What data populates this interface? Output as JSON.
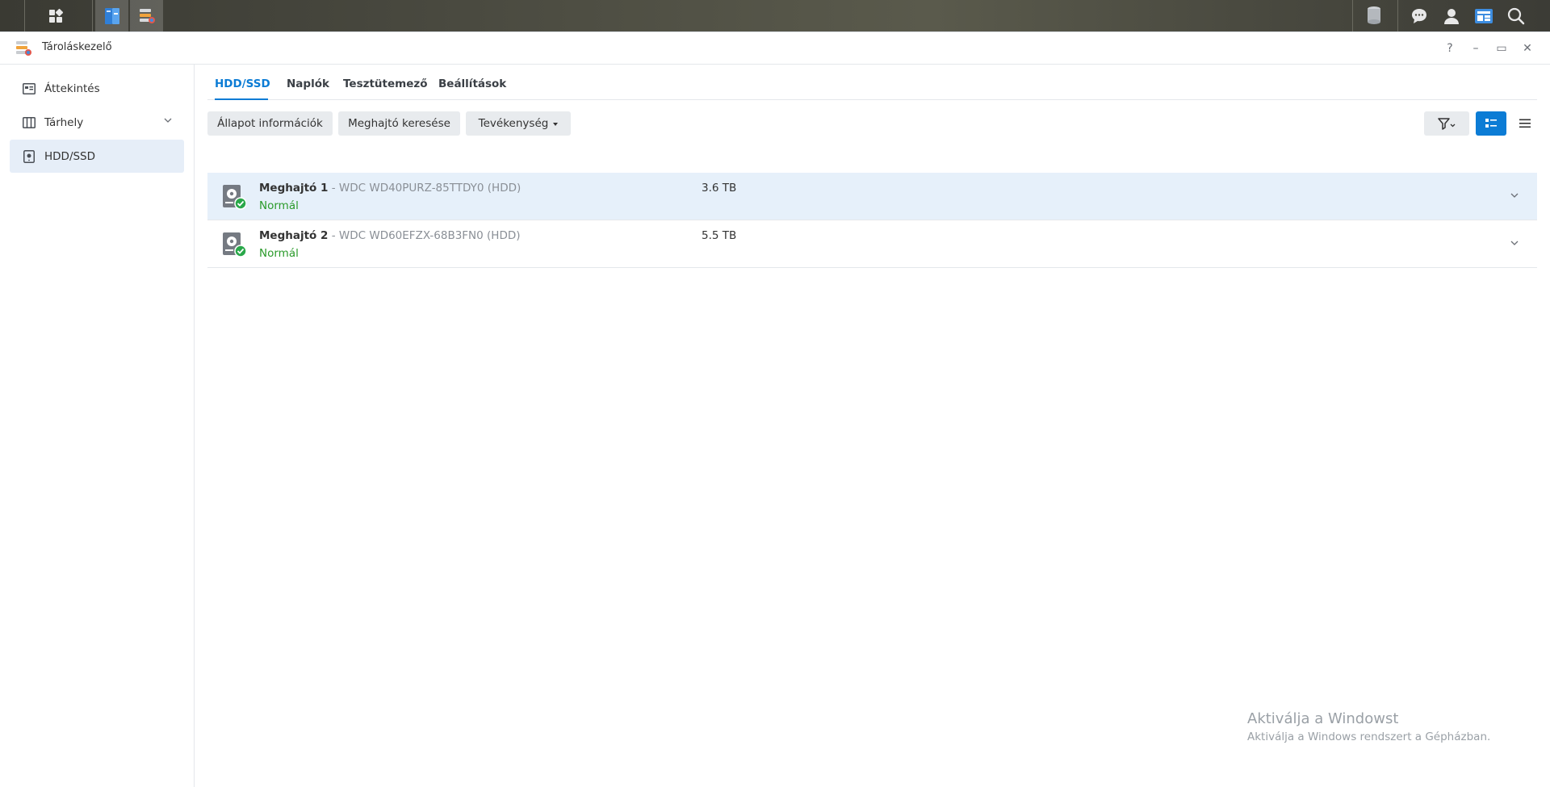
{
  "app": {
    "title": "Tároláskezelő"
  },
  "window_controls": {
    "help": "?",
    "minimize": "–",
    "restore": "▭",
    "close": "✕"
  },
  "sidebar": {
    "items": [
      {
        "label": "Áttekintés",
        "icon": "overview-icon"
      },
      {
        "label": "Tárhely",
        "icon": "storage-icon"
      },
      {
        "label": "HDD/SSD",
        "icon": "hdd-icon"
      }
    ]
  },
  "tabs": [
    {
      "label": "HDD/SSD"
    },
    {
      "label": "Naplók"
    },
    {
      "label": "Tesztütemező"
    },
    {
      "label": "Beállítások"
    }
  ],
  "toolbar": {
    "status_info": "Állapot információk",
    "find_drive": "Meghajtó keresése",
    "action": "Tevékenység"
  },
  "drives": [
    {
      "name": "Meghajtó 1",
      "model": " - WDC WD40PURZ-85TTDY0 (HDD)",
      "status": "Normál",
      "size": "3.6 TB"
    },
    {
      "name": "Meghajtó 2",
      "model": " - WDC WD60EFZX-68B3FN0 (HDD)",
      "status": "Normál",
      "size": "5.5 TB"
    }
  ],
  "watermark": {
    "title": "Aktiválja a Windowst",
    "subtitle": "Aktiválja a Windows rendszert a Gépházban."
  },
  "colors": {
    "accent": "#0c7cd5",
    "status_ok": "#2a9a2a",
    "selected_row": "#e6f0fa"
  }
}
